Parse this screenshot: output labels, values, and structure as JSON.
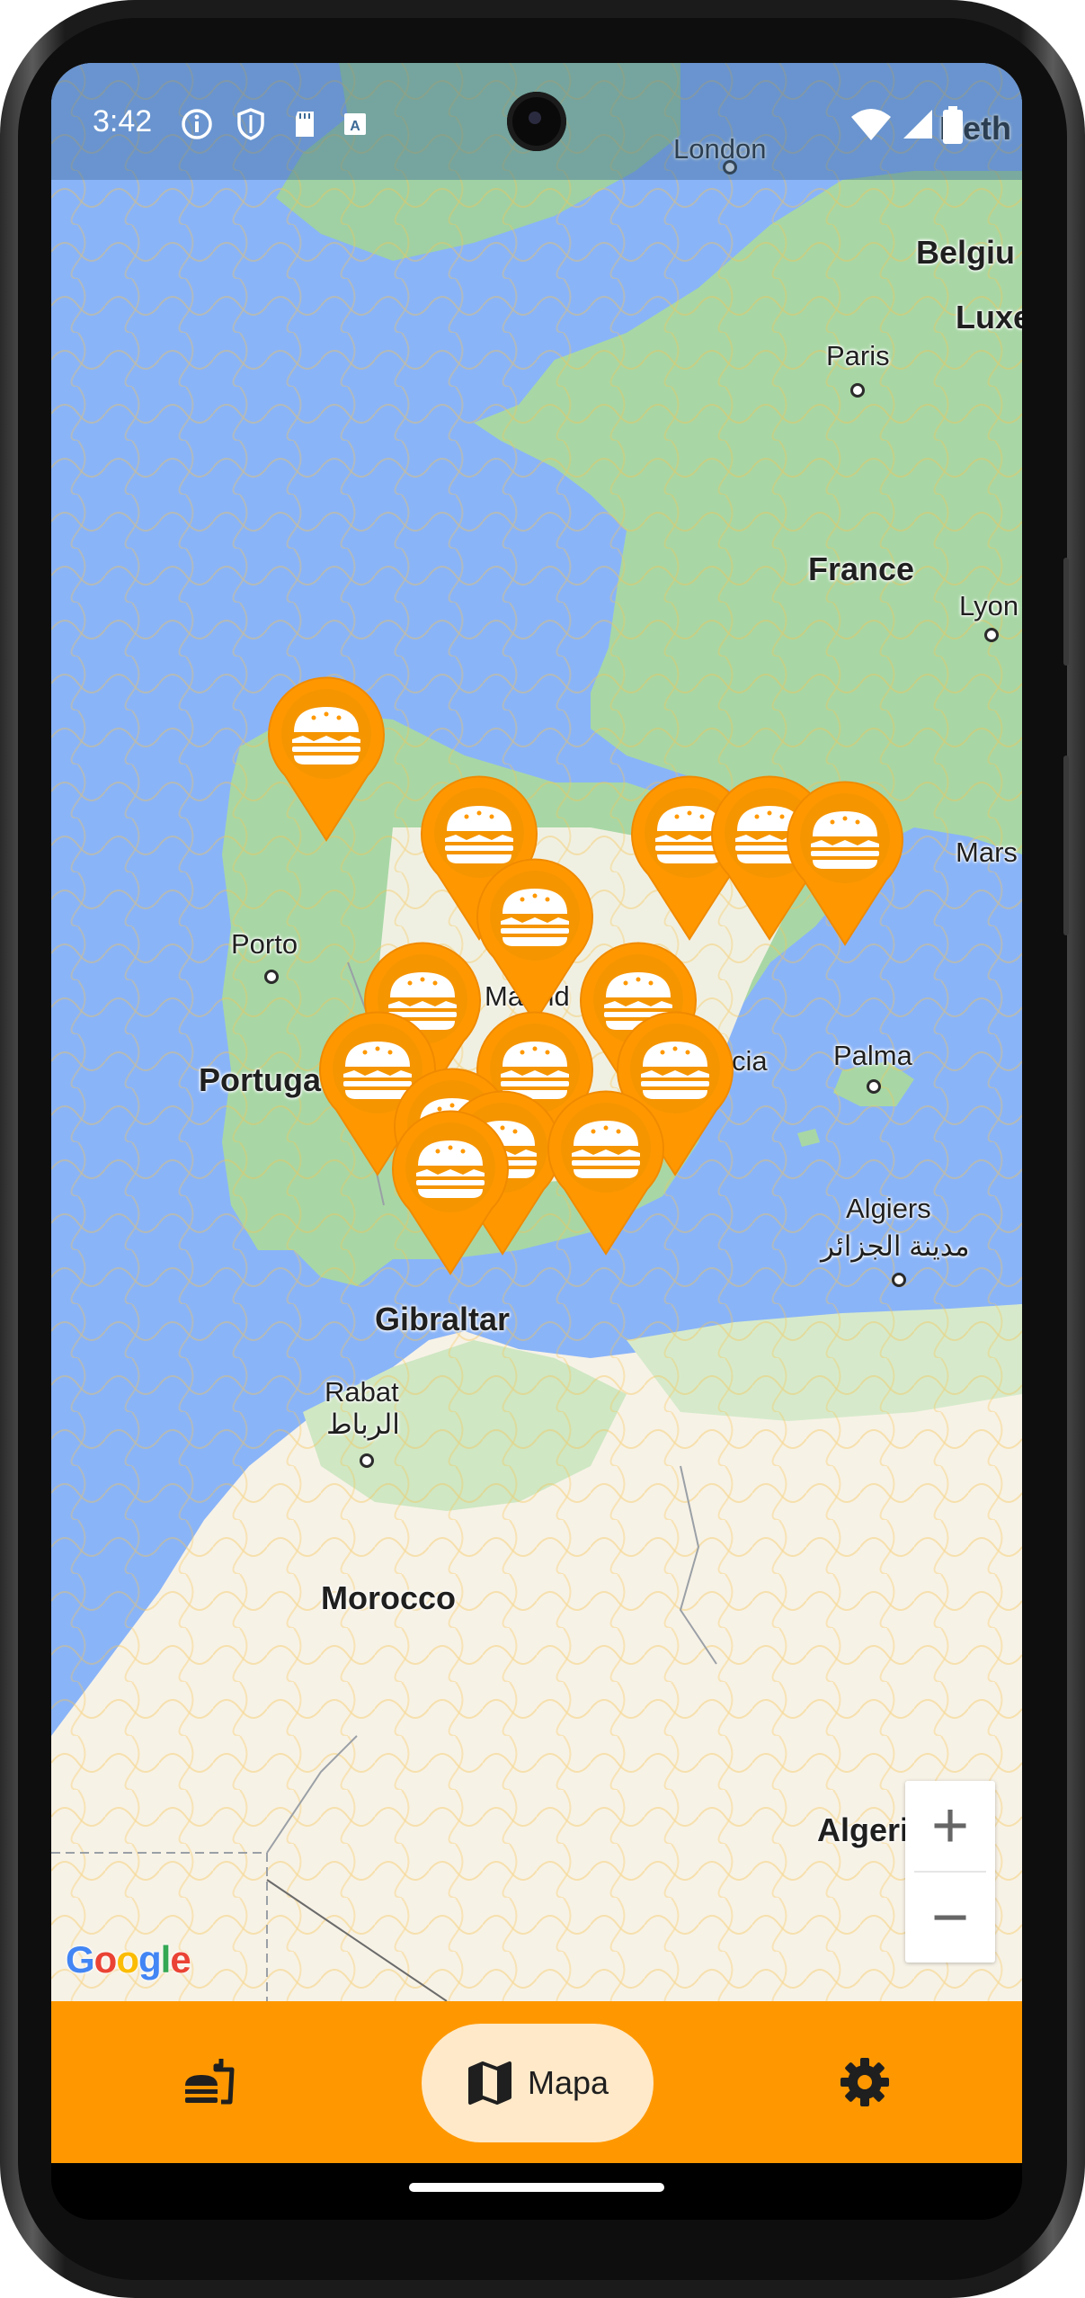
{
  "status_bar": {
    "time": "3:42",
    "icons": [
      "info-icon",
      "shield-icon",
      "sd-card-icon",
      "text-a-icon",
      "wifi-icon",
      "signal-icon",
      "battery-icon"
    ]
  },
  "map": {
    "provider_logo": "Google",
    "labels": {
      "london": "London",
      "netherlands": "Neth",
      "belgium": "Belgiu",
      "luxembourg": "Luxe",
      "paris": "Paris",
      "france": "France",
      "lyon": "Lyon",
      "marseille": "Mars",
      "porto": "Porto",
      "portugal": "Portuga",
      "madrid": "Madrid",
      "valencia": "Valencia",
      "palma": "Palma",
      "algiers": "Algiers",
      "algiers_ar": "مدينة الجزائر",
      "gibraltar": "Gibraltar",
      "rabat": "Rabat",
      "rabat_ar": "الرباط",
      "morocco": "Morocco",
      "algeria": "Algeria"
    },
    "marker_icon": "burger-icon",
    "marker_color": "#ff9800",
    "marker_count": 15
  },
  "zoom": {
    "in_label": "+",
    "out_label": "−"
  },
  "bottom_nav": {
    "items": [
      {
        "icon": "fastfood-icon",
        "label": ""
      },
      {
        "icon": "map-icon",
        "label": "Mapa",
        "selected": true
      },
      {
        "icon": "settings-icon",
        "label": ""
      }
    ],
    "background": "#ff9800",
    "selected_pill_color": "#ffe9c9"
  }
}
